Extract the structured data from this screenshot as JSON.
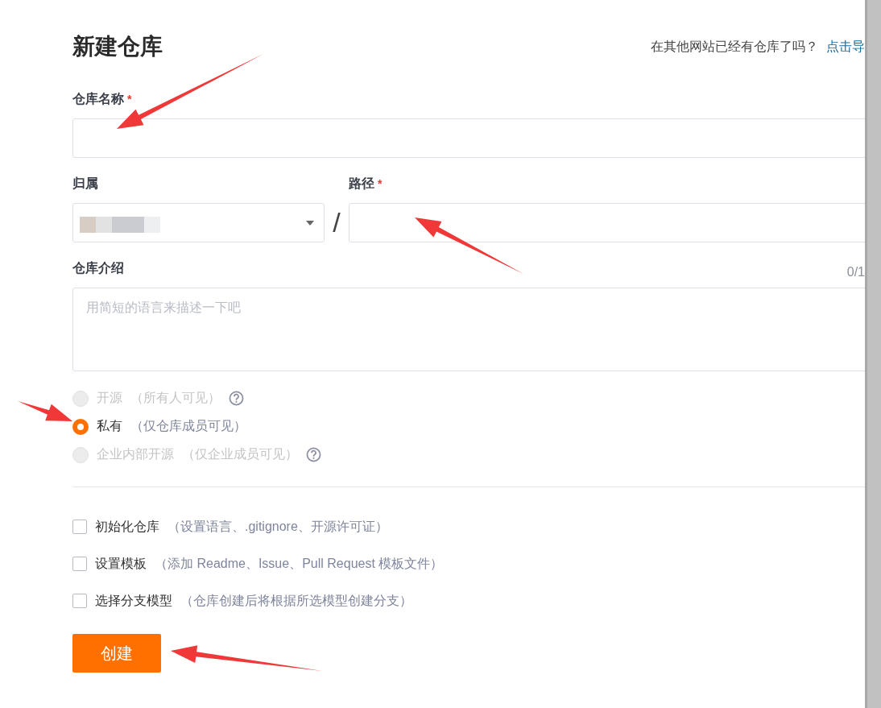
{
  "header": {
    "title": "新建仓库",
    "import_prompt": "在其他网站已经有仓库了吗？",
    "import_link": "点击导"
  },
  "fields": {
    "name": {
      "label": "仓库名称",
      "required_mark": "*"
    },
    "owner": {
      "label": "归属",
      "separator": "/"
    },
    "path": {
      "label": "路径",
      "required_mark": "*"
    },
    "description": {
      "label": "仓库介绍",
      "counter": "0/1",
      "placeholder": "用简短的语言来描述一下吧"
    }
  },
  "visibility": [
    {
      "label": "开源",
      "note": "（所有人可见）",
      "selected": false,
      "disabled": true,
      "help": true
    },
    {
      "label": "私有",
      "note": "（仅仓库成员可见）",
      "selected": true,
      "disabled": false,
      "help": false
    },
    {
      "label": "企业内部开源",
      "note": "（仅企业成员可见）",
      "selected": false,
      "disabled": true,
      "help": true
    }
  ],
  "options": [
    {
      "label": "初始化仓库",
      "note": "（设置语言、.gitignore、开源许可证）",
      "checked": false
    },
    {
      "label": "设置模板",
      "note": "（添加 Readme、Issue、Pull Request 模板文件）",
      "checked": false
    },
    {
      "label": "选择分支模型",
      "note": "（仓库创建后将根据所选模型创建分支）",
      "checked": false
    }
  ],
  "submit": "创建"
}
